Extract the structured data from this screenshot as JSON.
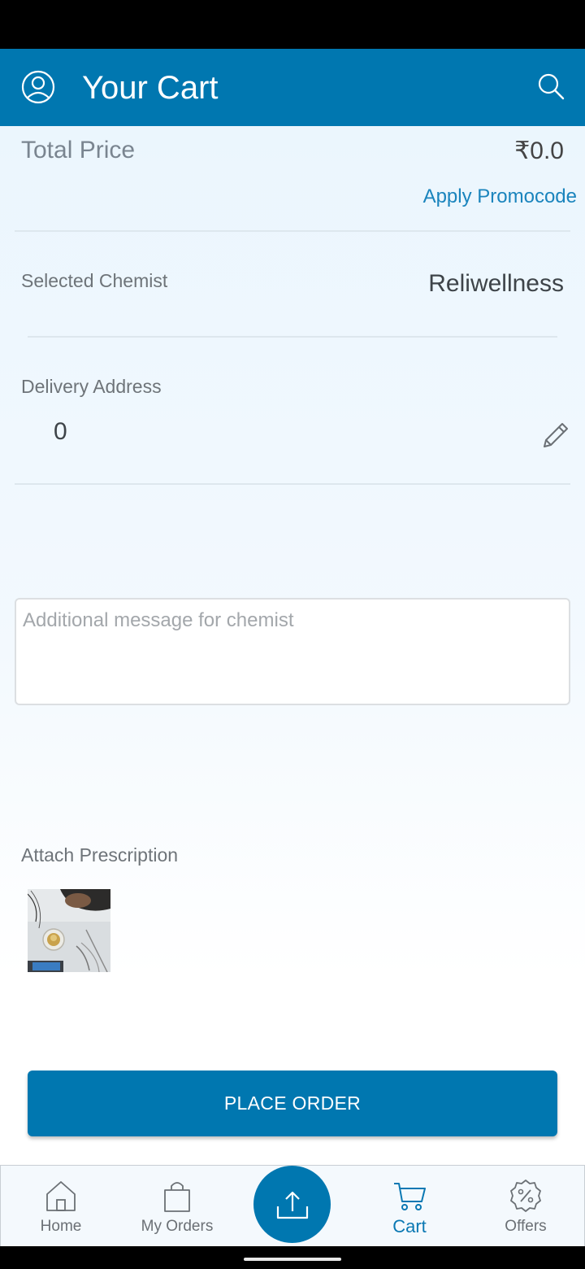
{
  "header": {
    "title": "Your Cart",
    "icons": {
      "profile": "user-circle-icon",
      "search": "search-icon"
    }
  },
  "summary": {
    "total_label": "Total Price",
    "total_value": "₹0.0",
    "promo_link": "Apply Promocode"
  },
  "chemist": {
    "label": "Selected Chemist",
    "value": "Reliwellness"
  },
  "delivery": {
    "label": "Delivery Address",
    "value": "0",
    "edit_icon": "pencil-icon"
  },
  "message": {
    "placeholder": "Additional message for chemist",
    "value": ""
  },
  "prescription": {
    "label": "Attach Prescription",
    "thumbnail_icon": "prescription-photo"
  },
  "actions": {
    "place_order": "PLACE ORDER"
  },
  "bottom_nav": {
    "items": [
      {
        "label": "Home",
        "icon": "home-icon",
        "active": false
      },
      {
        "label": "My Orders",
        "icon": "shopping-bag-icon",
        "active": false
      },
      {
        "label": "Cart",
        "icon": "cart-icon",
        "active": true
      },
      {
        "label": "Offers",
        "icon": "discount-badge-icon",
        "active": false
      }
    ],
    "fab_icon": "upload-icon"
  },
  "colors": {
    "primary": "#0077b0",
    "link": "#1a84bd",
    "text_muted": "#6e7479",
    "background": "#e9f5fd"
  }
}
